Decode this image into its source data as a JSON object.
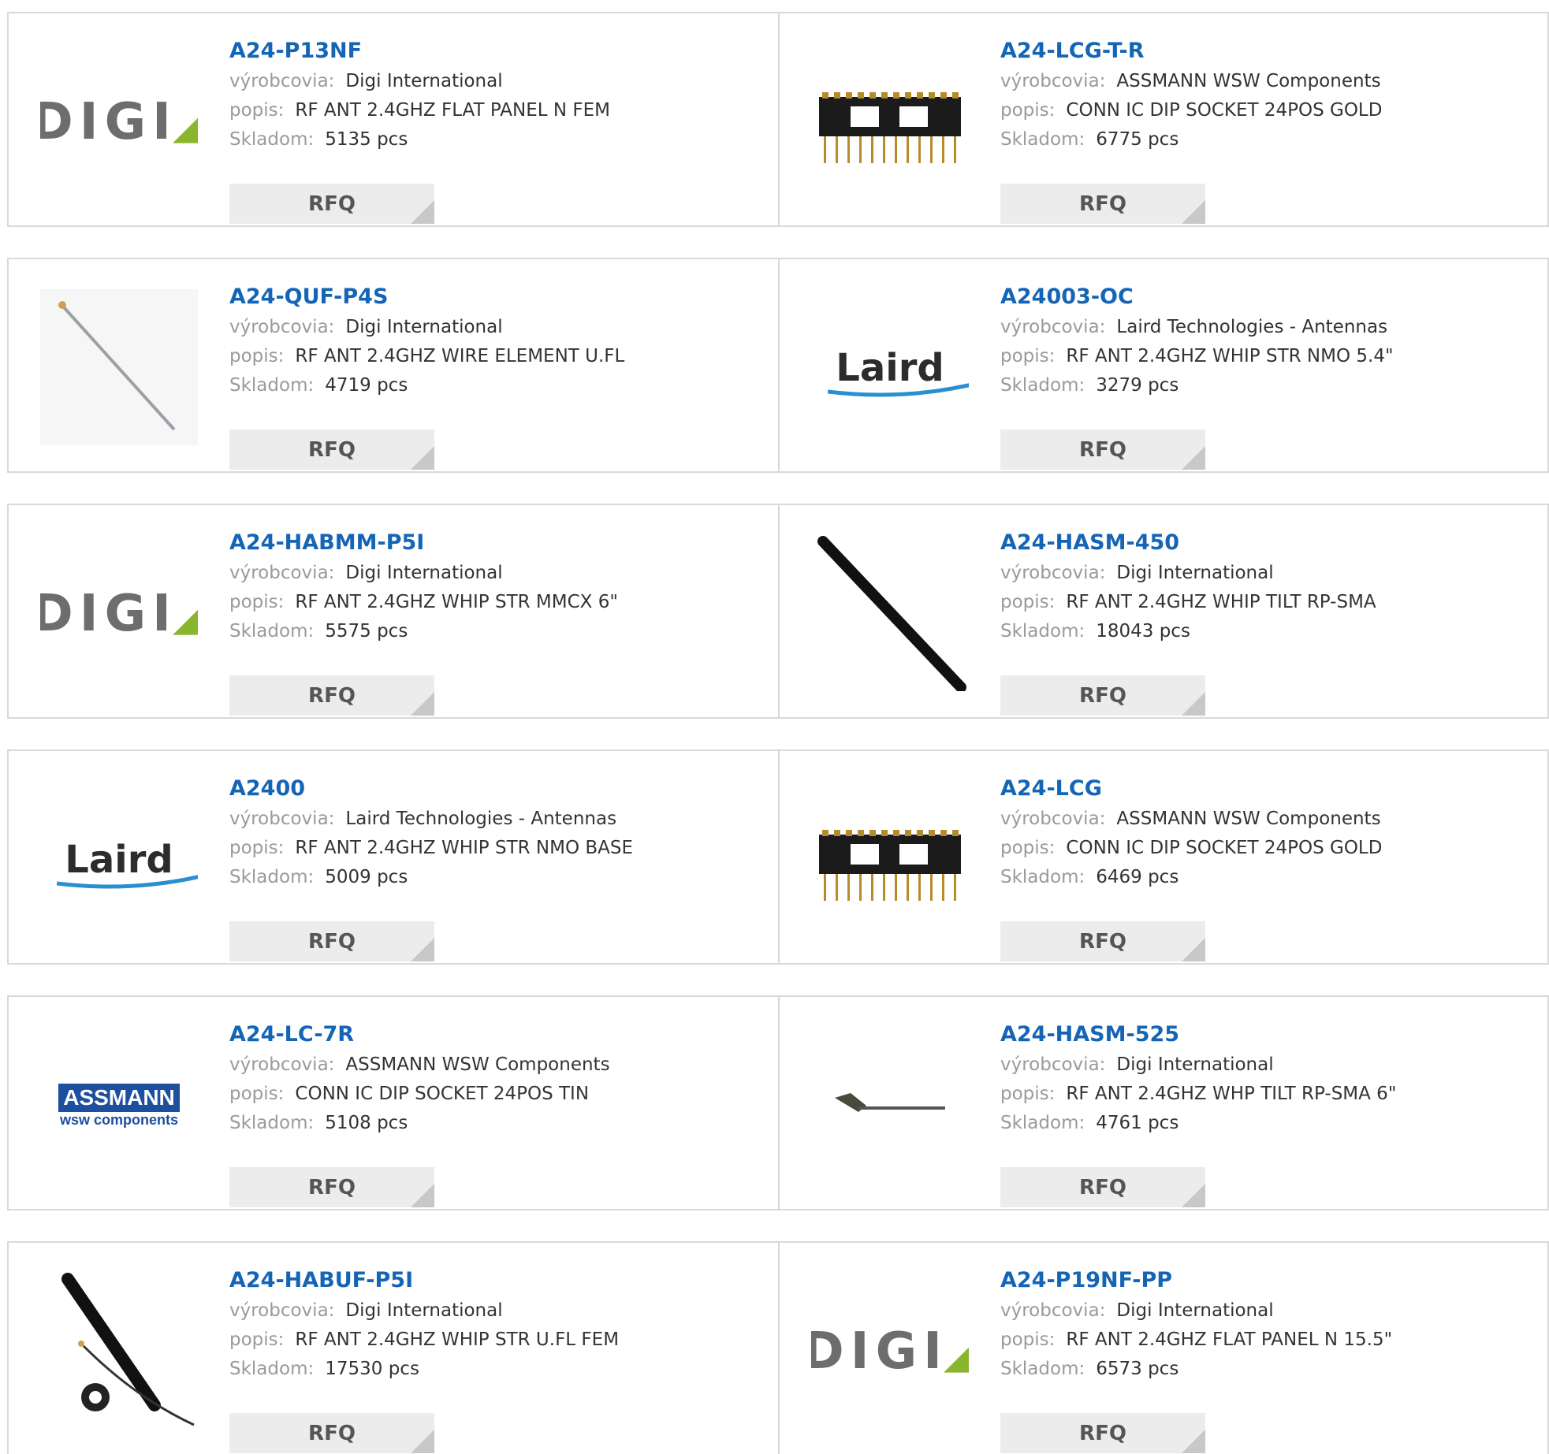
{
  "labels": {
    "manufacturer": "výrobcovia:",
    "description": "popis:",
    "stock": "Skladom:",
    "rfq": "RFQ"
  },
  "rows": [
    [
      {
        "part": "A24-P13NF",
        "manufacturer": "Digi International",
        "description": "RF ANT 2.4GHZ FLAT PANEL N FEM",
        "stock": "5135 pcs",
        "image": "digi-logo"
      },
      {
        "part": "A24-LCG-T-R",
        "manufacturer": "ASSMANN WSW Components",
        "description": "CONN IC DIP SOCKET 24POS GOLD",
        "stock": "6775 pcs",
        "image": "dip-socket"
      }
    ],
    [
      {
        "part": "A24-QUF-P4S",
        "manufacturer": "Digi International",
        "description": "RF ANT 2.4GHZ WIRE ELEMENT U.FL",
        "stock": "4719 pcs",
        "image": "wire-antenna"
      },
      {
        "part": "A24003-OC",
        "manufacturer": "Laird Technologies - Antennas",
        "description": "RF ANT 2.4GHZ WHIP STR NMO 5.4\"",
        "stock": "3279 pcs",
        "image": "laird-logo"
      }
    ],
    [
      {
        "part": "A24-HABMM-P5I",
        "manufacturer": "Digi International",
        "description": "RF ANT 2.4GHZ WHIP STR MMCX 6\"",
        "stock": "5575 pcs",
        "image": "digi-logo"
      },
      {
        "part": "A24-HASM-450",
        "manufacturer": "Digi International",
        "description": "RF ANT 2.4GHZ WHIP TILT RP-SMA",
        "stock": "18043 pcs",
        "image": "whip-antenna"
      }
    ],
    [
      {
        "part": "A2400",
        "manufacturer": "Laird Technologies - Antennas",
        "description": "RF ANT 2.4GHZ WHIP STR NMO BASE",
        "stock": "5009 pcs",
        "image": "laird-logo"
      },
      {
        "part": "A24-LCG",
        "manufacturer": "ASSMANN WSW Components",
        "description": "CONN IC DIP SOCKET 24POS GOLD",
        "stock": "6469 pcs",
        "image": "dip-socket"
      }
    ],
    [
      {
        "part": "A24-LC-7R",
        "manufacturer": "ASSMANN WSW Components",
        "description": "CONN IC DIP SOCKET 24POS TIN",
        "stock": "5108 pcs",
        "image": "assmann-logo"
      },
      {
        "part": "A24-HASM-525",
        "manufacturer": "Digi International",
        "description": "RF ANT 2.4GHZ WHP TILT RP-SMA 6\"",
        "stock": "4761 pcs",
        "image": "tilt-antenna"
      }
    ],
    [
      {
        "part": "A24-HABUF-P5I",
        "manufacturer": "Digi International",
        "description": "RF ANT 2.4GHZ WHIP STR U.FL FEM",
        "stock": "17530 pcs",
        "image": "whip-kit"
      },
      {
        "part": "A24-P19NF-PP",
        "manufacturer": "Digi International",
        "description": "RF ANT 2.4GHZ FLAT PANEL N 15.5\"",
        "stock": "6573 pcs",
        "image": "digi-logo"
      }
    ]
  ],
  "logos": {
    "digi": "DIGI",
    "laird": "Laird",
    "assmann_top": "ASSMANN",
    "assmann_bottom": "wsw components"
  }
}
